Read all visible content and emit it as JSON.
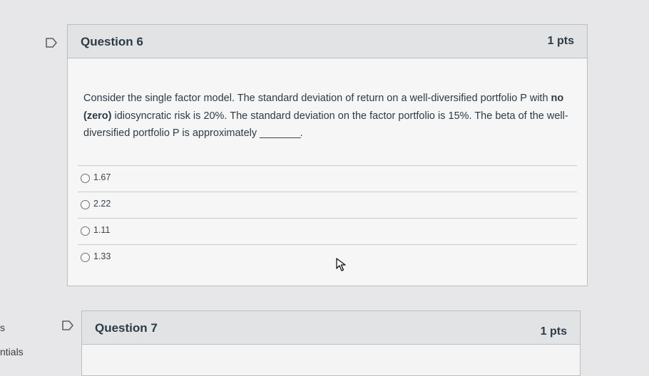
{
  "sidebar": {
    "items": [
      {
        "label": "s"
      },
      {
        "label": "ntials"
      }
    ]
  },
  "questions": [
    {
      "title": "Question 6",
      "points": "1 pts",
      "text_parts": [
        "Consider the single factor model. The standard deviation of return on a well-diversified portfolio P with ",
        "no (zero)",
        " idiosyncratic risk is 20%. The standard deviation on the factor portfolio is 15%. The beta of the well-diversified portfolio P is approximately ",
        "________."
      ],
      "answers": [
        {
          "label": "1.67"
        },
        {
          "label": "2.22"
        },
        {
          "label": "1.11"
        },
        {
          "label": "1.33"
        }
      ]
    },
    {
      "title": "Question 7",
      "points": "1 pts"
    }
  ],
  "icons": {
    "flag": "flag-icon",
    "cursor": "mouse-pointer-icon",
    "radio": "radio-unchecked-icon"
  },
  "colors": {
    "background": "#e7e7e9",
    "header": "#e2e3e5",
    "border": "#b9bec3",
    "text": "#2d3b45"
  }
}
